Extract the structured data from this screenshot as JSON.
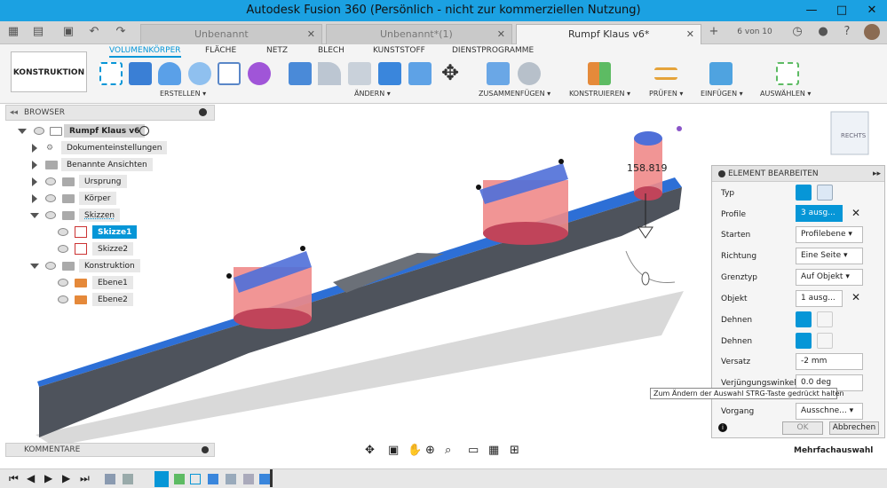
{
  "window": {
    "title": "Autodesk Fusion 360 (Persönlich - nicht zur kommerziellen Nutzung)"
  },
  "tabs": [
    {
      "label": "Unbenannt"
    },
    {
      "label": "Unbenannt*(1)"
    },
    {
      "label": "Rumpf Klaus v6*"
    }
  ],
  "tabbar": {
    "counter": "6 von 10"
  },
  "ribbon": {
    "tabs": [
      "VOLUMENKÖRPER",
      "FLÄCHE",
      "NETZ",
      "BLECH",
      "KUNSTSTOFF",
      "DIENSTPROGRAMME"
    ],
    "workspace": "KONSTRUKTION",
    "groups": [
      "ERSTELLEN",
      "ÄNDERN",
      "ZUSAMMENFÜGEN",
      "KONSTRUIEREN",
      "PRÜFEN",
      "EINFÜGEN",
      "AUSWÄHLEN"
    ]
  },
  "browser": {
    "title": "BROWSER",
    "items": [
      {
        "label": "Rumpf Klaus v6"
      },
      {
        "label": "Dokumenteinstellungen"
      },
      {
        "label": "Benannte Ansichten"
      },
      {
        "label": "Ursprung"
      },
      {
        "label": "Körper"
      },
      {
        "label": "Skizzen"
      },
      {
        "label": "Skizze1"
      },
      {
        "label": "Skizze2"
      },
      {
        "label": "Konstruktion"
      },
      {
        "label": "Ebene1"
      },
      {
        "label": "Ebene2"
      }
    ]
  },
  "canvas": {
    "dimension": "158.819",
    "viewcube": "RECHTS"
  },
  "panel": {
    "title": "ELEMENT BEARBEITEN",
    "rows": [
      {
        "label": "Typ"
      },
      {
        "label": "Profile",
        "value": "3 ausg..."
      },
      {
        "label": "Starten",
        "value": "Profilebene"
      },
      {
        "label": "Richtung",
        "value": "Eine Seite"
      },
      {
        "label": "Grenztyp",
        "value": "Auf Objekt"
      },
      {
        "label": "Objekt",
        "value": "1 ausg..."
      },
      {
        "label": "Dehnen"
      },
      {
        "label": "Dehnen"
      },
      {
        "label": "Versatz",
        "value": "-2 mm"
      },
      {
        "label": "Verjüngungswinkel",
        "value": "0.0 deg"
      },
      {
        "label": "Vorgang",
        "value": "Ausschne..."
      }
    ],
    "ok": "OK",
    "cancel": "Abbrechen"
  },
  "tooltip": "Zum Ändern der Auswahl STRG-Taste gedrückt halten",
  "comments": {
    "label": "KOMMENTARE"
  },
  "status": {
    "selection": "Mehrfachauswahl"
  },
  "colors": {
    "accent": "#0696d7",
    "titlebar": "#1ba1e2",
    "hull_top": "#2d6fd6",
    "hull_side": "#4e535c",
    "cut_fill": "#f08a8a"
  }
}
